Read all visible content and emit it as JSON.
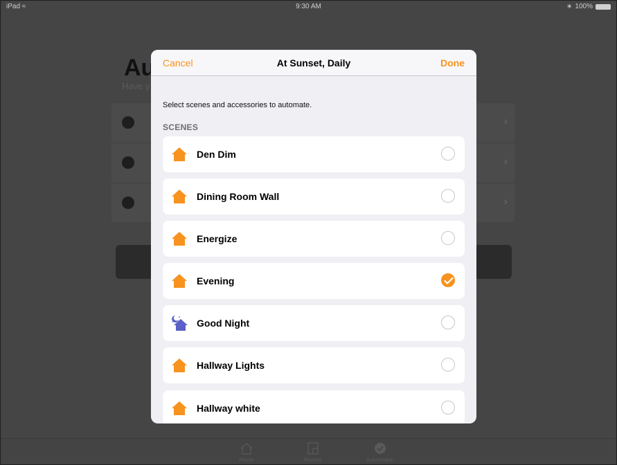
{
  "status_bar": {
    "device": "iPad",
    "time": "9:30 AM",
    "battery": "100%"
  },
  "background": {
    "title": "Au",
    "subtitle": "Have y",
    "tabs": [
      {
        "label": "Home"
      },
      {
        "label": "Rooms"
      },
      {
        "label": "Automation"
      }
    ]
  },
  "sheet": {
    "cancel_label": "Cancel",
    "title": "At Sunset, Daily",
    "done_label": "Done",
    "instruction": "Select scenes and accessories to automate.",
    "section_header": "SCENES",
    "scenes": [
      {
        "label": "Den Dim",
        "icon": "house-icon",
        "selected": false
      },
      {
        "label": "Dining Room Wall",
        "icon": "house-icon",
        "selected": false
      },
      {
        "label": "Energize",
        "icon": "house-icon",
        "selected": false
      },
      {
        "label": "Evening",
        "icon": "house-icon",
        "selected": true
      },
      {
        "label": "Good Night",
        "icon": "moon-house-icon",
        "selected": false
      },
      {
        "label": "Hallway Lights",
        "icon": "house-icon",
        "selected": false
      },
      {
        "label": "Hallway white",
        "icon": "house-icon",
        "selected": false
      }
    ]
  },
  "colors": {
    "accent": "#f7931e",
    "night_icon": "#5b5fc7"
  }
}
